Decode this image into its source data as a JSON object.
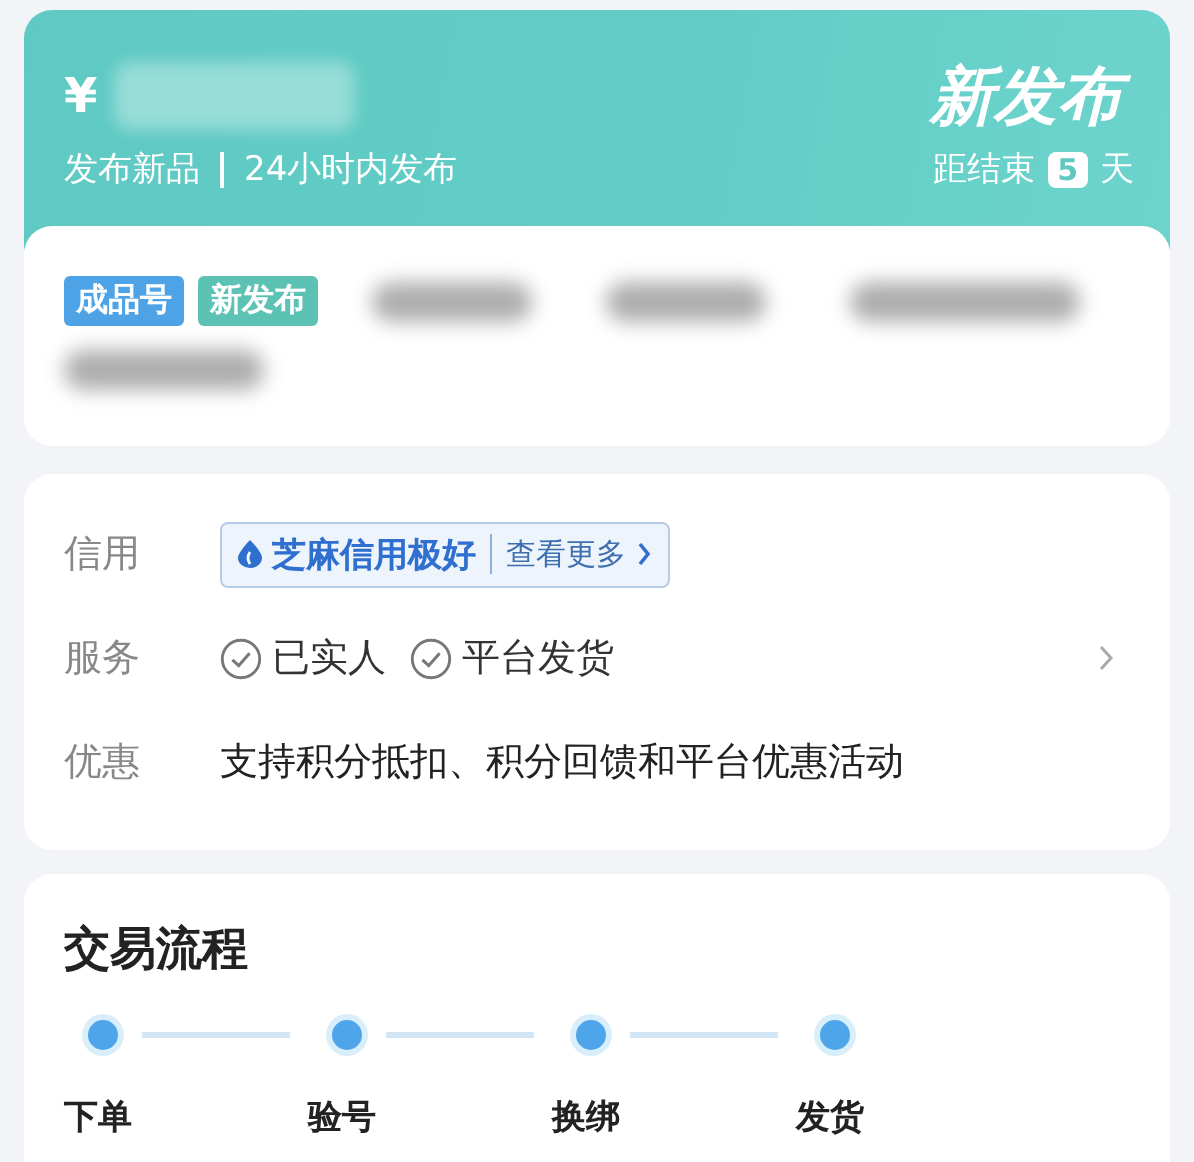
{
  "header": {
    "currency": "¥",
    "subtitle_left": "发布新品",
    "subtitle_right": "24小时内发布",
    "title": "新发布",
    "countdown_prefix": "距结束",
    "countdown_days": "5",
    "countdown_suffix": "天"
  },
  "product": {
    "tags": [
      {
        "label": "成品号",
        "color": "#4ea3e6"
      },
      {
        "label": "新发布",
        "color": "#5cc2b4"
      }
    ]
  },
  "info": {
    "credit": {
      "label": "信用",
      "badge": "芝麻信用极好",
      "link": "查看更多"
    },
    "service": {
      "label": "服务",
      "items": [
        "已实人",
        "平台发货"
      ]
    },
    "promo": {
      "label": "优惠",
      "text": "支持积分抵扣、积分回馈和平台优惠活动"
    }
  },
  "process": {
    "title": "交易流程",
    "steps": [
      "下单",
      "验号",
      "换绑",
      "发货"
    ]
  }
}
